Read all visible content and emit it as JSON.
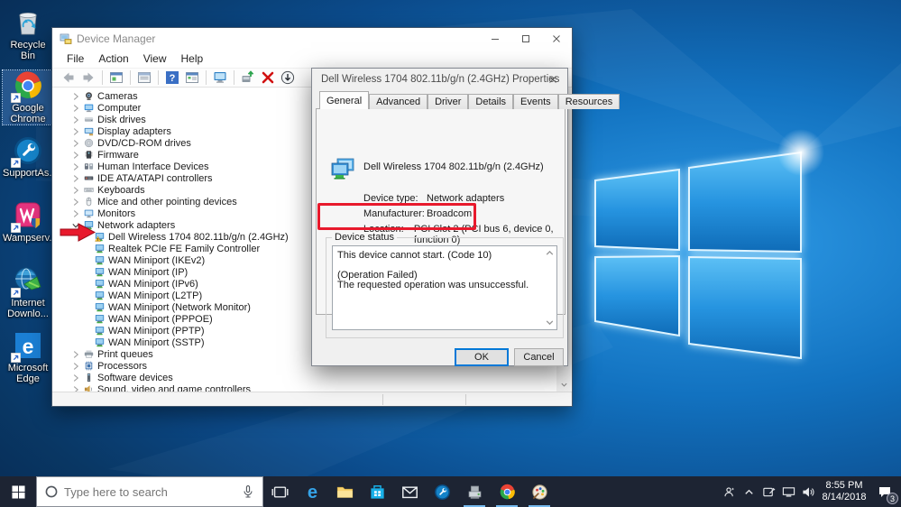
{
  "desktop": {
    "icons": [
      {
        "name": "recycle-bin",
        "label": "Recycle Bin",
        "shortcut": false,
        "selected": false
      },
      {
        "name": "google-chrome",
        "label": "Google Chrome",
        "shortcut": true,
        "selected": true
      },
      {
        "name": "supportassist",
        "label": "SupportAs...",
        "shortcut": true,
        "selected": false
      },
      {
        "name": "wampserver",
        "label": "Wampserv...",
        "shortcut": true,
        "selected": false
      },
      {
        "name": "internet-download-manager",
        "label": "Internet Downlo...",
        "shortcut": true,
        "selected": false
      },
      {
        "name": "microsoft-edge",
        "label": "Microsoft Edge",
        "shortcut": true,
        "selected": false
      }
    ]
  },
  "device_manager": {
    "title": "Device Manager",
    "menu": [
      "File",
      "Action",
      "View",
      "Help"
    ],
    "toolbar": [
      "back",
      "forward",
      "sep",
      "console-window",
      "sep",
      "properties-window",
      "sep",
      "help",
      "console-tree",
      "sep",
      "remote-monitor",
      "sep",
      "update-driver",
      "uninstall",
      "scan-hardware"
    ],
    "tree": [
      {
        "label": "Cameras",
        "icon": "camera",
        "chevron": "right"
      },
      {
        "label": "Computer",
        "icon": "computer",
        "chevron": "right"
      },
      {
        "label": "Disk drives",
        "icon": "disk",
        "chevron": "right"
      },
      {
        "label": "Display adapters",
        "icon": "display",
        "chevron": "right"
      },
      {
        "label": "DVD/CD-ROM drives",
        "icon": "dvd",
        "chevron": "right"
      },
      {
        "label": "Firmware",
        "icon": "firmware",
        "chevron": "right"
      },
      {
        "label": "Human Interface Devices",
        "icon": "hid",
        "chevron": "right"
      },
      {
        "label": "IDE ATA/ATAPI controllers",
        "icon": "ide",
        "chevron": "right"
      },
      {
        "label": "Keyboards",
        "icon": "keyboard",
        "chevron": "right"
      },
      {
        "label": "Mice and other pointing devices",
        "icon": "mouse",
        "chevron": "right"
      },
      {
        "label": "Monitors",
        "icon": "monitor",
        "chevron": "right"
      },
      {
        "label": "Network adapters",
        "icon": "network",
        "chevron": "down"
      },
      {
        "label": "Dell Wireless 1704 802.11b/g/n (2.4GHz)",
        "icon": "network-warning",
        "indent": 1
      },
      {
        "label": "Realtek PCIe FE Family Controller",
        "icon": "network",
        "indent": 1
      },
      {
        "label": "WAN Miniport (IKEv2)",
        "icon": "network",
        "indent": 1
      },
      {
        "label": "WAN Miniport (IP)",
        "icon": "network",
        "indent": 1
      },
      {
        "label": "WAN Miniport (IPv6)",
        "icon": "network",
        "indent": 1
      },
      {
        "label": "WAN Miniport (L2TP)",
        "icon": "network",
        "indent": 1
      },
      {
        "label": "WAN Miniport (Network Monitor)",
        "icon": "network",
        "indent": 1
      },
      {
        "label": "WAN Miniport (PPPOE)",
        "icon": "network",
        "indent": 1
      },
      {
        "label": "WAN Miniport (PPTP)",
        "icon": "network",
        "indent": 1
      },
      {
        "label": "WAN Miniport (SSTP)",
        "icon": "network",
        "indent": 1
      },
      {
        "label": "Print queues",
        "icon": "printer",
        "chevron": "right"
      },
      {
        "label": "Processors",
        "icon": "processor",
        "chevron": "right"
      },
      {
        "label": "Software devices",
        "icon": "software",
        "chevron": "right"
      },
      {
        "label": "Sound, video and game controllers",
        "icon": "sound",
        "chevron": "right"
      }
    ]
  },
  "dialog": {
    "title": "Dell Wireless 1704 802.11b/g/n (2.4GHz) Properties",
    "tabs": [
      "General",
      "Advanced",
      "Driver",
      "Details",
      "Events",
      "Resources"
    ],
    "active_tab": "General",
    "device_name": "Dell Wireless 1704 802.11b/g/n (2.4GHz)",
    "fields": [
      {
        "label": "Device type:",
        "value": "Network adapters"
      },
      {
        "label": "Manufacturer:",
        "value": "Broadcom"
      },
      {
        "label": "Location:",
        "value": "PCI Slot 2 (PCI bus 6, device 0, function 0)"
      }
    ],
    "device_status_label": "Device status",
    "status_lines": [
      "This device cannot start. (Code 10)",
      "(Operation Failed)",
      "The requested operation was unsuccessful."
    ],
    "ok_label": "OK",
    "cancel_label": "Cancel"
  },
  "annotations": {
    "highlight_color": "#e8192c",
    "arrow_color": "#e8192c"
  },
  "taskbar": {
    "search_placeholder": "Type here to search",
    "apps": [
      {
        "name": "task-view",
        "open": false
      },
      {
        "name": "edge",
        "open": false
      },
      {
        "name": "file-explorer",
        "open": false
      },
      {
        "name": "store",
        "open": false
      },
      {
        "name": "mail",
        "open": false
      },
      {
        "name": "supportassist-tb",
        "open": false
      },
      {
        "name": "device-manager-tb",
        "open": true
      },
      {
        "name": "chrome-tb",
        "open": true
      },
      {
        "name": "paint",
        "open": true
      }
    ],
    "tray_icons": [
      "people",
      "chevron-up",
      "tablet-pen",
      "network-tray",
      "speaker"
    ],
    "clock": {
      "time": "8:55 PM",
      "date": "8/14/2018"
    },
    "notification_count": "3"
  }
}
